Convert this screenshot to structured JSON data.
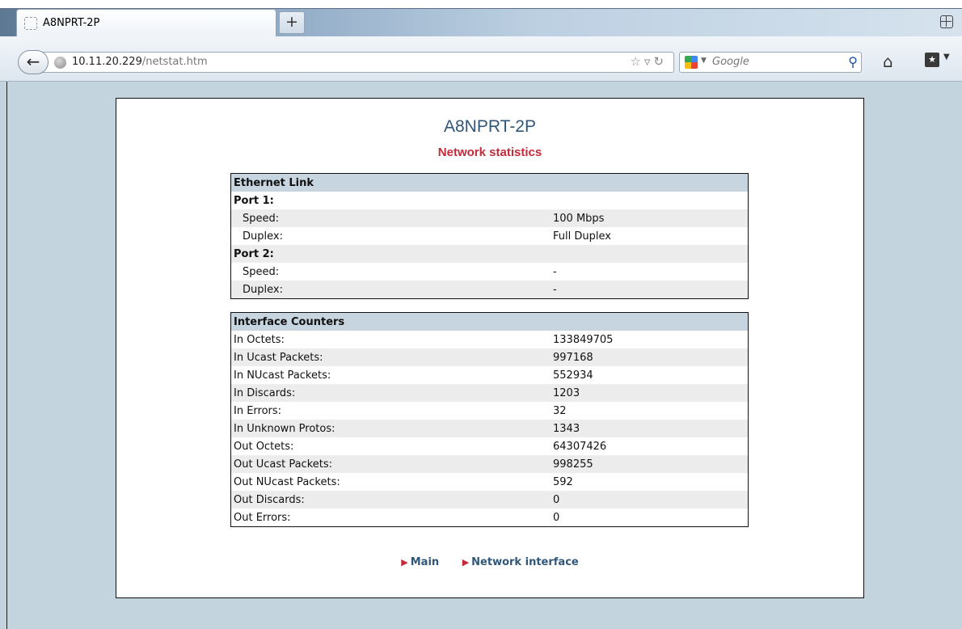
{
  "browser": {
    "tab_title": "A8NPRT-2P",
    "new_tab_label": "+",
    "url_host": "10.11.20.229",
    "url_path": "/netstat.htm",
    "search_placeholder": "Google"
  },
  "page": {
    "device_name": "A8NPRT-2P",
    "subtitle": "Network statistics"
  },
  "ethernet": {
    "header": "Ethernet Link",
    "port1_label": "Port 1:",
    "port1_speed_label": "Speed:",
    "port1_speed": "100 Mbps",
    "port1_duplex_label": "Duplex:",
    "port1_duplex": "Full Duplex",
    "port2_label": "Port 2:",
    "port2_speed_label": "Speed:",
    "port2_speed": "-",
    "port2_duplex_label": "Duplex:",
    "port2_duplex": "-"
  },
  "counters": {
    "header": "Interface Counters",
    "rows": [
      {
        "label": "In Octets:",
        "value": "133849705"
      },
      {
        "label": "In Ucast Packets:",
        "value": "997168"
      },
      {
        "label": "In NUcast Packets:",
        "value": "552934"
      },
      {
        "label": "In Discards:",
        "value": "1203"
      },
      {
        "label": "In Errors:",
        "value": "32"
      },
      {
        "label": "In Unknown Protos:",
        "value": "1343"
      },
      {
        "label": "Out Octets:",
        "value": "64307426"
      },
      {
        "label": "Out Ucast Packets:",
        "value": "998255"
      },
      {
        "label": "Out NUcast Packets:",
        "value": "592"
      },
      {
        "label": "Out Discards:",
        "value": "0"
      },
      {
        "label": "Out Errors:",
        "value": "0"
      }
    ]
  },
  "nav": {
    "main_label": "Main",
    "network_interface_label": "Network interface"
  }
}
